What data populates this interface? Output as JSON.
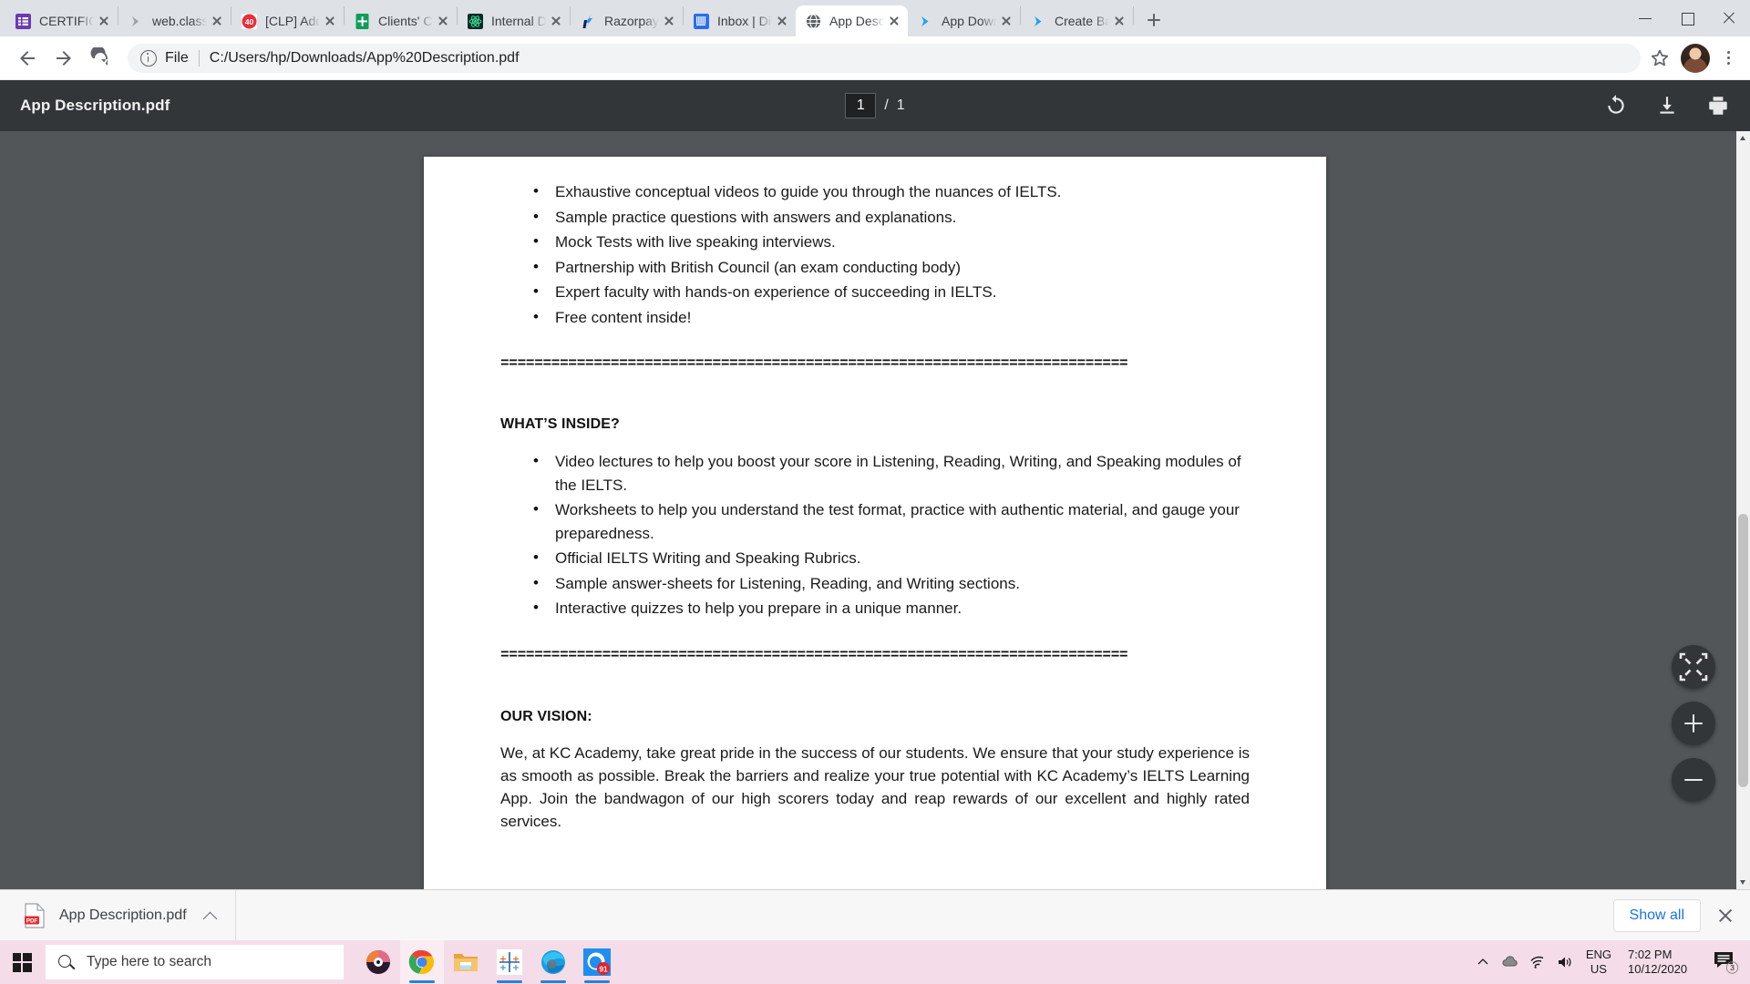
{
  "browser": {
    "tabs": [
      {
        "title": "CERTIFICATE",
        "favicon": "list-purple-icon",
        "active": false
      },
      {
        "title": "web.classplu",
        "favicon": "chevron-gray-icon",
        "active": false
      },
      {
        "title": "[CLP] Add Iss",
        "favicon": "badge-40-red-icon",
        "active": false
      },
      {
        "title": "Clients' CSM",
        "favicon": "sheets-green-icon",
        "active": false
      },
      {
        "title": "Internal Das",
        "favicon": "react-atom-icon",
        "active": false
      },
      {
        "title": "Razorpay Da",
        "favicon": "razorpay-blue-icon",
        "active": false
      },
      {
        "title": "Inbox | Digit",
        "favicon": "mail-blue-icon",
        "active": false
      },
      {
        "title": "App Descrip",
        "favicon": "globe-icon",
        "active": true
      },
      {
        "title": "App Downlo",
        "favicon": "chevron-blue-icon",
        "active": false
      },
      {
        "title": "Create Batch",
        "favicon": "chevron-blue-icon",
        "active": false
      }
    ],
    "new_tab_label": "+",
    "window_controls": {
      "minimize": "minimize-icon",
      "maximize": "maximize-icon",
      "close": "close-icon"
    },
    "toolbar": {
      "back": "back-arrow-icon",
      "forward": "forward-arrow-icon",
      "reload": "reload-icon",
      "scheme_label": "File",
      "url": "C:/Users/hp/Downloads/App%20Description.pdf",
      "bookmark": "star-icon",
      "profile": "avatar",
      "menu": "kebab-menu-icon"
    }
  },
  "pdf_viewer": {
    "title": "App Description.pdf",
    "current_page": "1",
    "separator": "/",
    "total_pages": "1",
    "actions": {
      "rotate": "rotate-icon",
      "download": "download-icon",
      "print": "print-icon"
    },
    "zoom_controls": {
      "fit": "fit-to-page-icon",
      "zoom_in": "plus-icon",
      "zoom_out": "minus-icon"
    }
  },
  "document": {
    "top_list": [
      "Exhaustive conceptual videos to guide you through the nuances of IELTS.",
      "Sample practice questions with answers and explanations.",
      "Mock Tests with live speaking interviews.",
      "Partnership with British Council (an exam conducting body)",
      "Expert faculty with hands-on experience of succeeding in IELTS.",
      "Free content inside!"
    ],
    "divider1": "==========================================================================",
    "whats_inside_heading": "WHAT’S INSIDE?",
    "whats_inside_list": [
      "Video lectures to help you boost your score in Listening, Reading, Writing, and Speaking modules of the IELTS.",
      "Worksheets to help you understand the test format, practice with authentic material, and gauge your preparedness.",
      "Official IELTS Writing and Speaking Rubrics.",
      "Sample answer-sheets for Listening, Reading, and Writing sections.",
      "Interactive quizzes to help you prepare in a unique manner."
    ],
    "divider2": "==========================================================================",
    "vision_heading": "OUR VISION:",
    "vision_paragraph": "We, at KC Academy, take great pride in the success of our students. We ensure that your study experience is as smooth as possible. Break the barriers and realize your true potential with KC Academy’s IELTS Learning App. Join the bandwagon of our high scorers today and reap rewards of our excellent and highly rated services."
  },
  "download_bar": {
    "file_name": "App Description.pdf",
    "file_icon": "pdf-file-icon",
    "expand": "chevron-up-icon",
    "show_all_label": "Show all",
    "close": "close-icon"
  },
  "taskbar": {
    "start": "windows-logo-icon",
    "search_placeholder": "Type here to search",
    "apps": [
      {
        "name": "groove-music-icon"
      },
      {
        "name": "google-chrome-icon"
      },
      {
        "name": "file-explorer-icon"
      },
      {
        "name": "tableau-icon"
      },
      {
        "name": "microsoft-edge-icon"
      },
      {
        "name": "whatsapp-icon",
        "badge": "91"
      }
    ],
    "tray": {
      "overflow": "chevron-up-icon",
      "onedrive": "cloud-icon",
      "network": "wifi-icon",
      "volume": "speaker-icon",
      "language_line1": "ENG",
      "language_line2": "US",
      "time": "7:02 PM",
      "date": "10/12/2020",
      "notifications_icon": "action-center-icon",
      "notifications_count": "3"
    }
  },
  "colors": {
    "chrome_tabstrip": "#dee1e6",
    "pdf_chrome": "#323639",
    "pdf_backdrop": "#525659",
    "accent_blue": "#1a73e8",
    "taskbar": "#f4dde8"
  }
}
